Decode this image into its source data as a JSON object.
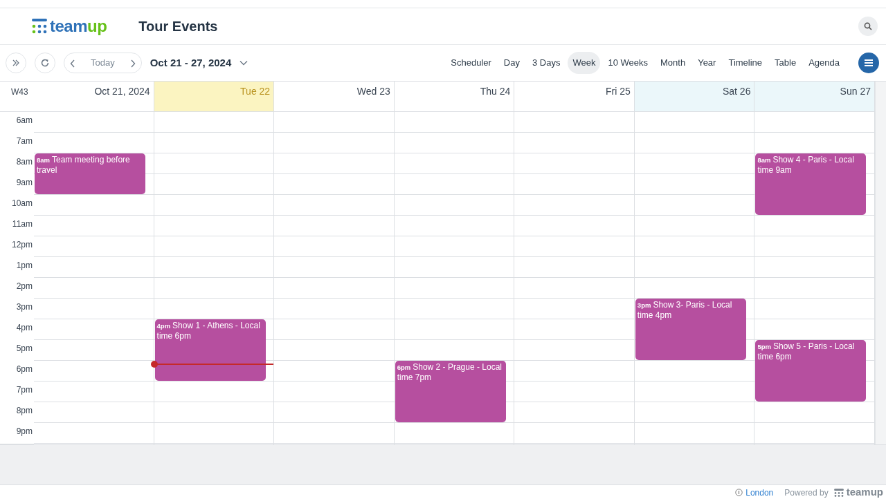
{
  "header": {
    "logo": [
      {
        "text": "team",
        "color": "#2f72b8"
      },
      {
        "text": "up",
        "color": "#67c11a"
      }
    ],
    "title": "Tour Events"
  },
  "toolbar": {
    "today": "Today",
    "range": "Oct 21 - 27, 2024",
    "views": [
      {
        "label": "Scheduler",
        "selected": false
      },
      {
        "label": "Day",
        "selected": false
      },
      {
        "label": "3 Days",
        "selected": false
      },
      {
        "label": "Week",
        "selected": true
      },
      {
        "label": "10 Weeks",
        "selected": false
      },
      {
        "label": "Month",
        "selected": false
      },
      {
        "label": "Year",
        "selected": false
      },
      {
        "label": "Timeline",
        "selected": false
      },
      {
        "label": "Table",
        "selected": false
      },
      {
        "label": "Agenda",
        "selected": false
      }
    ]
  },
  "calendar": {
    "week": "W43",
    "hours": [
      {
        "label": "6am",
        "current": false
      },
      {
        "label": "7am",
        "current": false
      },
      {
        "label": "8am",
        "current": false
      },
      {
        "label": "9am",
        "current": false
      },
      {
        "label": "10am",
        "current": false
      },
      {
        "label": "11am",
        "current": false
      },
      {
        "label": "12pm",
        "current": false
      },
      {
        "label": "1pm",
        "current": false
      },
      {
        "label": "2pm",
        "current": false
      },
      {
        "label": "3pm",
        "current": false
      },
      {
        "label": "4pm",
        "current": false
      },
      {
        "label": "5pm",
        "current": false
      },
      {
        "label": "6pm",
        "current": true
      },
      {
        "label": "7pm",
        "current": false
      },
      {
        "label": "8pm",
        "current": false
      },
      {
        "label": "9pm",
        "current": false
      }
    ],
    "days": [
      {
        "label": "Oct 21, 2024",
        "kind": "weekday",
        "events": [
          {
            "time": "8am",
            "title": "Team meeting before travel",
            "kind": "two-hour"
          }
        ]
      },
      {
        "label": "Tue 22",
        "kind": "today",
        "events": [
          {
            "time": "4pm",
            "title": "Show 1 - Athens - Local time 6pm",
            "kind": "three-hour"
          }
        ]
      },
      {
        "label": "Wed 23",
        "kind": "weekday"
      },
      {
        "label": "Thu 24",
        "kind": "weekday",
        "events": [
          {
            "time": "6pm",
            "title": "Show 2 - Prague - Local time 7pm",
            "kind": "three-hour"
          }
        ]
      },
      {
        "label": "Fri 25",
        "kind": "weekday"
      },
      {
        "label": "Sat 26",
        "kind": "weekend",
        "events": [
          {
            "time": "3pm",
            "title": "Show 3- Paris - Local time 4pm",
            "kind": "three-hour"
          }
        ]
      },
      {
        "label": "Sun 27",
        "kind": "weekend",
        "events": [
          {
            "time": "8am",
            "title": "Show 4 - Paris - Local time 9am",
            "kind": "three-hour"
          },
          {
            "time": "5pm",
            "title": "Show 5 - Paris - Local time 6pm",
            "kind": "three-hour"
          }
        ]
      }
    ]
  },
  "footer": {
    "timezone": "London",
    "powered": "Powered by",
    "brand": "teamup"
  }
}
